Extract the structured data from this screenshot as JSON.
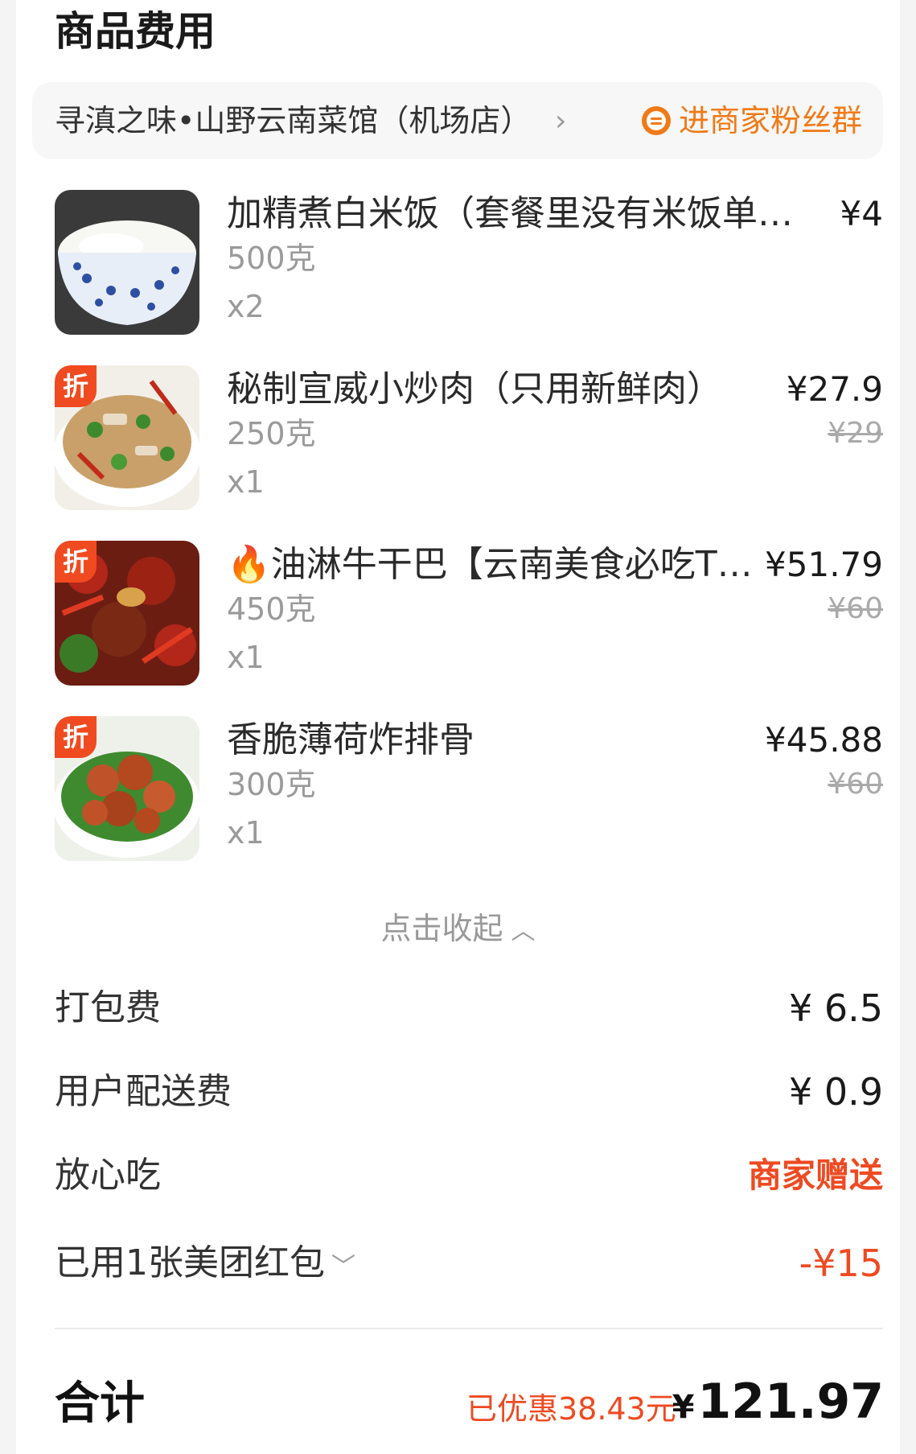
{
  "section_title": "商品费用",
  "store": {
    "name": "寻滇之味•山野云南菜馆（机场店）",
    "chevron": "›",
    "fan_group_label": "进商家粉丝群"
  },
  "items": [
    {
      "name": "加精煮白米饭（套餐里没有米饭单…",
      "weight": "500克",
      "qty": "x2",
      "price": "¥4",
      "original_price": "",
      "badge": ""
    },
    {
      "name": "秘制宣威小炒肉（只用新鲜肉）",
      "weight": "250克",
      "qty": "x1",
      "price": "¥27.9",
      "original_price": "¥29",
      "badge": "折"
    },
    {
      "name": "🔥油淋牛干巴【云南美食必吃T…",
      "weight": "450克",
      "qty": "x1",
      "price": "¥51.79",
      "original_price": "¥60",
      "badge": "折"
    },
    {
      "name": "香脆薄荷炸排骨",
      "weight": "300克",
      "qty": "x1",
      "price": "¥45.88",
      "original_price": "¥60",
      "badge": "折"
    }
  ],
  "collapse_label": "点击收起",
  "fees": {
    "packing": {
      "label": "打包费",
      "value": "¥ 6.5"
    },
    "delivery": {
      "label": "用户配送费",
      "value": "¥ 0.9"
    },
    "assurance": {
      "label": "放心吃",
      "value": "商家赠送"
    },
    "coupon": {
      "label": "已用1张美团红包",
      "value": "-¥15"
    }
  },
  "total": {
    "label": "合计",
    "saved_text": "已优惠38.43元",
    "currency": "¥",
    "amount": "121.97"
  },
  "colors": {
    "accent_orange": "#f07a16",
    "discount_red": "#ee4a22",
    "badge_red": "#f04a20"
  }
}
